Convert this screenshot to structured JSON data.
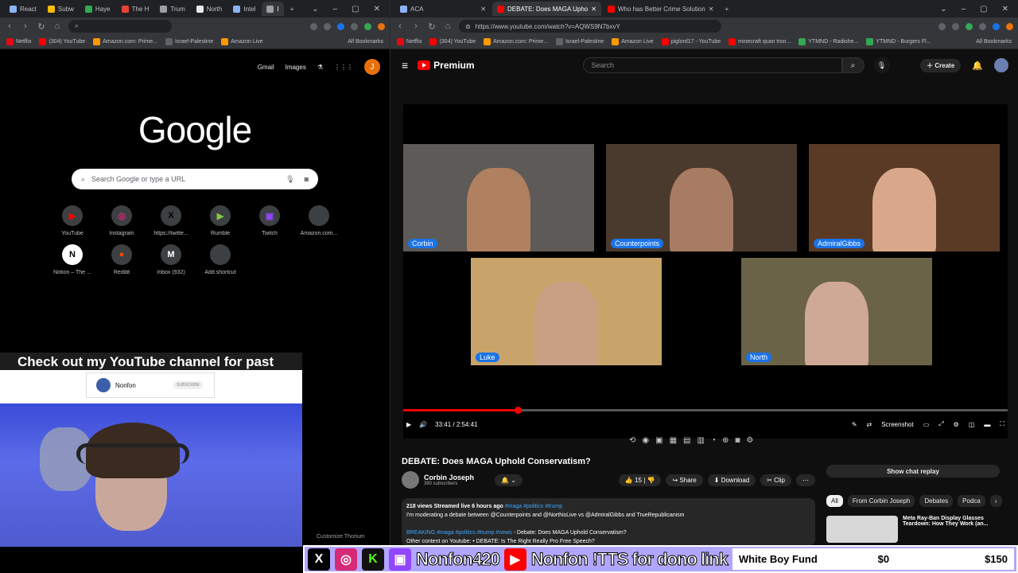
{
  "left_browser": {
    "tabs": [
      {
        "label": "React",
        "color": "#8ab4f8"
      },
      {
        "label": "Subw",
        "color": "#fbbc04"
      },
      {
        "label": "Haye",
        "color": "#34a853"
      },
      {
        "label": "The H",
        "color": "#ea4335"
      },
      {
        "label": "Trum",
        "color": "#9aa0a6"
      },
      {
        "label": "North",
        "color": "#e8eaed"
      },
      {
        "label": "Intel",
        "color": "#8ab4f8"
      },
      {
        "label": "I",
        "color": "#9aa0a6"
      }
    ],
    "address_value": "",
    "bookmarks": [
      "Netflix",
      "(304) YouTube",
      "Amazon.com: Prime...",
      "Israel-Palestine",
      "Amazon Live"
    ],
    "all_bookmarks": "All Bookmarks",
    "ntp": {
      "gmail": "Gmail",
      "images": "Images",
      "avatar_letter": "J",
      "logo": "Google",
      "search_placeholder": "Search Google or type a URL",
      "shortcuts": [
        {
          "label": "YouTube",
          "icon": "youtube-icon",
          "glyph": "▶",
          "color": "#ff0000"
        },
        {
          "label": "Instagram",
          "icon": "instagram-icon",
          "glyph": "◎",
          "color": "#d62976"
        },
        {
          "label": "https://twitte...",
          "icon": "x-icon",
          "glyph": "X",
          "color": "#000000"
        },
        {
          "label": "Rumble",
          "icon": "rumble-icon",
          "glyph": "▶",
          "color": "#85c742"
        },
        {
          "label": "Twitch",
          "icon": "twitch-icon",
          "glyph": "▣",
          "color": "#9146ff"
        },
        {
          "label": "Amazon.com...",
          "icon": "amazon-icon",
          "glyph": "a",
          "color": "#3c4043"
        },
        {
          "label": "Notion – The ...",
          "icon": "notion-icon",
          "glyph": "N",
          "color": "#ffffff"
        },
        {
          "label": "Reddit",
          "icon": "reddit-icon",
          "glyph": "●",
          "color": "#ff4500"
        },
        {
          "label": "Inbox (932)",
          "icon": "gmail-icon",
          "glyph": "M",
          "color": "#ffffff"
        },
        {
          "label": "Add shortcut",
          "icon": "plus-icon",
          "glyph": "+",
          "color": "#3c4043"
        }
      ],
      "customize": "Customize Thorium"
    }
  },
  "overlay": {
    "promo_title": "Check out my YouTube channel for past debates",
    "promo_channel": "Nonfon",
    "promo_subscribe": "SUBSCRIBE"
  },
  "right_browser": {
    "tabs": [
      {
        "label": "ACA",
        "active": false
      },
      {
        "label": "DEBATE: Does MAGA Upho",
        "active": true
      },
      {
        "label": "Who has Better Crime Solution",
        "active": false
      }
    ],
    "url": "https://www.youtube.com/watch?v=AQWS9N7bxvY",
    "bookmarks": [
      "Netflix",
      "(304) YouTube",
      "Amazon.com: Prime...",
      "Israel-Palestine",
      "Amazon Live",
      "piglord17 - YouTube",
      "minecraft quan tron...",
      "YTMND - Radiohe...",
      "YTMND - Burgers Fl..."
    ],
    "all_bookmarks": "All Bookmarks"
  },
  "youtube": {
    "logo": "Premium",
    "search_placeholder": "Search",
    "create": "Create",
    "participants": [
      {
        "name": "Corbin",
        "bg": "#5e5a58",
        "skin": "#b08060"
      },
      {
        "name": "Counterpoints",
        "bg": "#4a3a2e",
        "skin": "#a87c62"
      },
      {
        "name": "AdmiralGibbs",
        "bg": "#5a3a25",
        "skin": "#d9a88a"
      },
      {
        "name": "Luke",
        "bg": "#c9a46a",
        "skin": "#caa085"
      },
      {
        "name": "North",
        "bg": "#6a6348",
        "skin": "#cfa995"
      }
    ],
    "time": "33:41 / 2:54:41",
    "progress": 0.19,
    "screenshot": "Screenshot",
    "title": "DEBATE: Does MAGA Uphold Conservatism?",
    "channel": "Corbin Joseph",
    "subs": "380 subscribers",
    "likes": "15",
    "share": "Share",
    "download": "Download",
    "clip": "Clip",
    "desc_meta": "218 views  Streamed live 6 hours ago",
    "desc_tags": "#maga #politics #trump",
    "desc_line1": "I'm moderating a debate between @Counterpoints and @NorthisLive vs @AdmiralGibbs and TrueRepublicanism",
    "desc_line2_tags": "BREAKING #maga #politics #trump #news",
    "desc_line2": " - Debate: Does MAGA Uphold Conservatism?",
    "desc_line3": "Other content on Youtube:   • DEBATE: Is The Right Really Pro Free Speech?",
    "chat_replay": "Show chat replay",
    "chips": [
      "All",
      "From Corbin Joseph",
      "Debates",
      "Podca"
    ],
    "rec_title": "Meta Ray-Ban Display Glasses Teardown: How They Work (an..."
  },
  "streambar": {
    "handle1": "Nonfon420",
    "handle2": "Nonfon",
    "tts": "!TTS for dono link",
    "fund_label": "White Boy Fund",
    "fund_current": "$0",
    "fund_goal": "$150"
  }
}
